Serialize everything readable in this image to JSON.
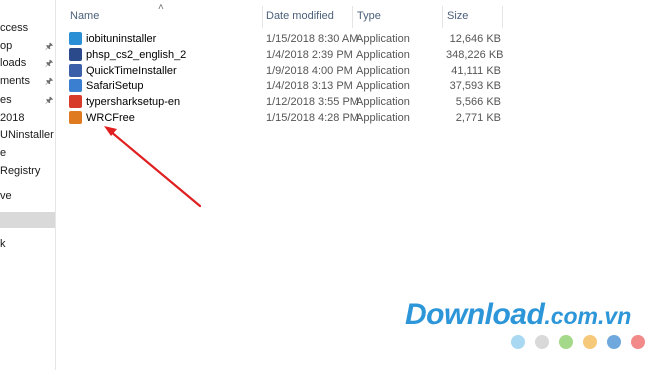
{
  "nav": {
    "items": [
      {
        "label": "ccess",
        "pinned": false,
        "selected": false
      },
      {
        "label": "op",
        "pinned": true,
        "selected": false
      },
      {
        "label": "loads",
        "pinned": true,
        "selected": false
      },
      {
        "label": "ments",
        "pinned": true,
        "selected": false
      },
      {
        "label": "es",
        "pinned": true,
        "selected": false
      },
      {
        "label": "2018",
        "pinned": false,
        "selected": false
      },
      {
        "label": "UNinstaller",
        "pinned": false,
        "selected": false
      },
      {
        "label": "e",
        "pinned": false,
        "selected": false
      },
      {
        "label": "Registry",
        "pinned": false,
        "selected": false
      },
      {
        "label": "ve",
        "pinned": false,
        "selected": false
      },
      {
        "label": "",
        "pinned": false,
        "selected": true
      },
      {
        "label": "k",
        "pinned": false,
        "selected": false
      }
    ]
  },
  "columns": {
    "name": "Name",
    "date": "Date modified",
    "type": "Type",
    "size": "Size"
  },
  "files": [
    {
      "name": "iobituninstaller",
      "date": "1/15/2018 8:30 AM",
      "type": "Application",
      "size": "12,646 KB",
      "icon": "iobit-icon",
      "color": "#2a8fd4"
    },
    {
      "name": "phsp_cs2_english_2",
      "date": "1/4/2018 2:39 PM",
      "type": "Application",
      "size": "348,226 KB",
      "icon": "photoshop-icon",
      "color": "#2b4a8c"
    },
    {
      "name": "QuickTimeInstaller",
      "date": "1/9/2018 4:00 PM",
      "type": "Application",
      "size": "41,111 KB",
      "icon": "quicktime-icon",
      "color": "#3b5fa8"
    },
    {
      "name": "SafariSetup",
      "date": "1/4/2018 3:13 PM",
      "type": "Application",
      "size": "37,593 KB",
      "icon": "safari-icon",
      "color": "#3a7fd0"
    },
    {
      "name": "typersharksetup-en",
      "date": "1/12/2018 3:55 PM",
      "type": "Application",
      "size": "5,566 KB",
      "icon": "typershark-icon",
      "color": "#d83a2a"
    },
    {
      "name": "WRCFree",
      "date": "1/15/2018 4:28 PM",
      "type": "Application",
      "size": "2,771 KB",
      "icon": "wrc-icon",
      "color": "#e07a20"
    }
  ],
  "watermark": {
    "main": "Download",
    "suffix": ".com.vn",
    "dot_colors": [
      "#a9d8f2",
      "#d9d9d9",
      "#a5d98a",
      "#f5c87a",
      "#6fa8dc",
      "#f28a8a"
    ]
  },
  "annotation": {
    "arrow_color": "#e02020"
  }
}
